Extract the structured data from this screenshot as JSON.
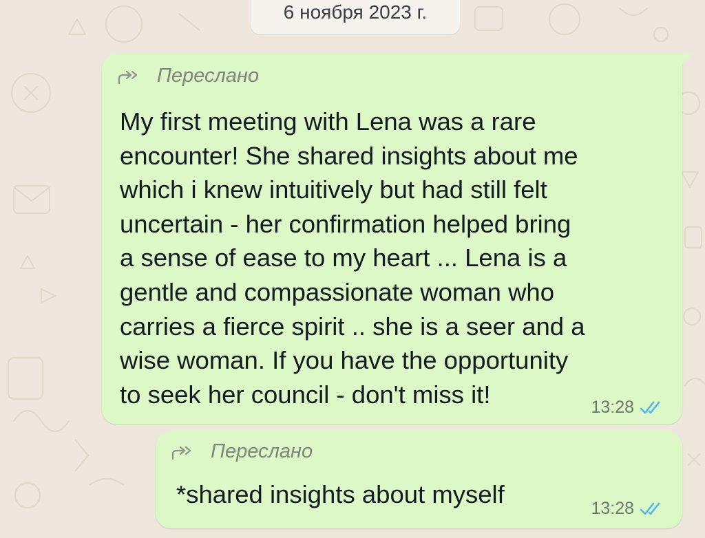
{
  "date_chip": "6 ноября 2023 г.",
  "messages": [
    {
      "forwarded_label": "Переслано",
      "text": "My first meeting with Lena was a rare\nencounter! She shared insights about me\nwhich i knew intuitively but had still felt\nuncertain - her confirmation helped bring\na sense of ease to my heart ... Lena is a\ngentle and compassionate woman who\ncarries a fierce spirit .. she is a seer and a\nwise woman. If you have the opportunity\nto seek her council - don't miss it!",
      "time": "13:28",
      "status_icon": "double-check-icon"
    },
    {
      "forwarded_label": "Переслано",
      "text": "*shared insights about myself",
      "time": "13:28",
      "status_icon": "double-check-icon"
    }
  ],
  "colors": {
    "background": "#efe7dd",
    "bubble": "#dcf8c6",
    "read_ticks": "#4fb6ec"
  }
}
